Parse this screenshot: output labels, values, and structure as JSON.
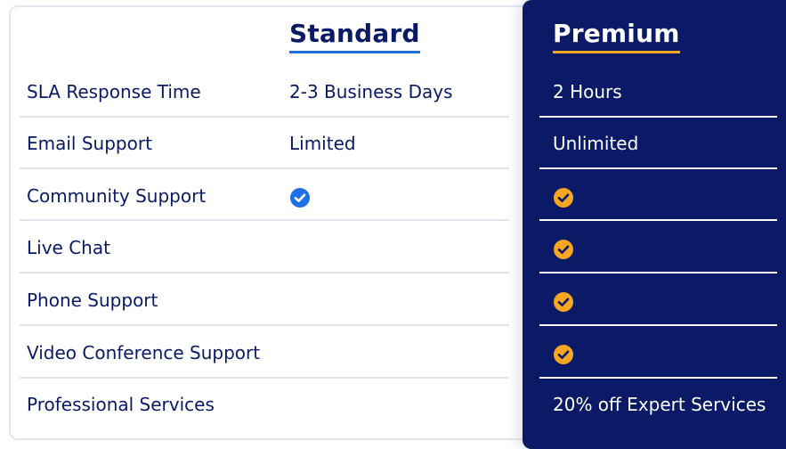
{
  "columns": {
    "standard": "Standard",
    "premium": "Premium"
  },
  "colors": {
    "navy": "#0a1a66",
    "standard_accent": "#1f6fe5",
    "premium_accent": "#f6a623"
  },
  "rows": [
    {
      "label": "SLA Response Time",
      "standard": "2-3 Business Days",
      "premium": "2 Hours"
    },
    {
      "label": "Email Support",
      "standard": "Limited",
      "premium": "Unlimited"
    },
    {
      "label": "Community Support",
      "standard_icon": "check-circle-blue-icon",
      "premium_icon": "check-circle-orange-icon"
    },
    {
      "label": "Live Chat",
      "premium_icon": "check-circle-orange-icon"
    },
    {
      "label": "Phone Support",
      "premium_icon": "check-circle-orange-icon"
    },
    {
      "label": "Video Conference Support",
      "premium_icon": "check-circle-orange-icon"
    },
    {
      "label": "Professional Services",
      "premium": "20% off Expert Services"
    }
  ]
}
